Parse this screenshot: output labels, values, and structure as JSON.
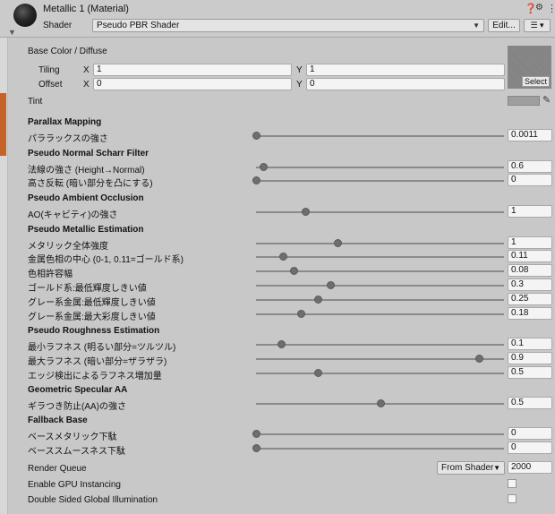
{
  "header": {
    "title": "Metallic 1 (Material)",
    "shader_label": "Shader",
    "shader_value": "Pseudo PBR Shader",
    "edit_label": "Edit...",
    "list_label": "☰ ▾"
  },
  "base": {
    "title": "Base Color / Diffuse",
    "tiling_label": "Tiling",
    "offset_label": "Offset",
    "x_label": "X",
    "y_label": "Y",
    "tiling_x": "1",
    "tiling_y": "1",
    "offset_x": "0",
    "offset_y": "0",
    "select_label": "Select",
    "tint_label": "Tint"
  },
  "sections": [
    {
      "title": "Parallax Mapping",
      "rows": [
        {
          "label": "パララックスの強さ",
          "value": "0.0011",
          "fraction": 0.0
        }
      ]
    },
    {
      "title": "Pseudo Normal Scharr Filter",
      "rows": [
        {
          "label": "法線の強さ (Height→Normal)",
          "value": "0.6",
          "fraction": 0.03
        },
        {
          "label": "高さ反転 (暗い部分を凸にする)",
          "value": "0",
          "fraction": 0.0
        }
      ]
    },
    {
      "title": "Pseudo Ambient Occlusion",
      "rows": [
        {
          "label": "AO(キャビティ)の強さ",
          "value": "1",
          "fraction": 0.2
        }
      ]
    },
    {
      "title": "Pseudo Metallic Estimation",
      "rows": [
        {
          "label": "メタリック全体強度",
          "value": "1",
          "fraction": 0.33
        },
        {
          "label": "金属色相の中心 (0-1, 0.11=ゴールド系)",
          "value": "0.11",
          "fraction": 0.11
        },
        {
          "label": "色相許容幅",
          "value": "0.08",
          "fraction": 0.15
        },
        {
          "label": "ゴールド系:最低輝度しきい値",
          "value": "0.3",
          "fraction": 0.3
        },
        {
          "label": "グレー系金属:最低輝度しきい値",
          "value": "0.25",
          "fraction": 0.25
        },
        {
          "label": "グレー系金属:最大彩度しきい値",
          "value": "0.18",
          "fraction": 0.18
        }
      ]
    },
    {
      "title": "Pseudo Roughness Estimation",
      "rows": [
        {
          "label": "最小ラフネス (明るい部分=ツルツル)",
          "value": "0.1",
          "fraction": 0.1
        },
        {
          "label": "最大ラフネス (暗い部分=ザラザラ)",
          "value": "0.9",
          "fraction": 0.9
        },
        {
          "label": "エッジ検出によるラフネス増加量",
          "value": "0.5",
          "fraction": 0.25
        }
      ]
    },
    {
      "title": "Geometric Specular AA",
      "rows": [
        {
          "label": "ギラつき防止(AA)の強さ",
          "value": "0.5",
          "fraction": 0.5
        }
      ]
    },
    {
      "title": "Fallback Base",
      "rows": [
        {
          "label": "ベースメタリック下駄",
          "value": "0",
          "fraction": 0.0
        },
        {
          "label": "ベーススムースネス下駄",
          "value": "0",
          "fraction": 0.0
        }
      ]
    }
  ],
  "footer": {
    "render_queue_label": "Render Queue",
    "render_queue_mode": "From Shader",
    "render_queue_value": "2000",
    "gpu_instancing_label": "Enable GPU Instancing",
    "gpu_instancing_checked": false,
    "double_sided_label": "Double Sided Global Illumination",
    "double_sided_checked": false
  },
  "colors": {
    "panel_bg": "#c8c8c8",
    "tint": "#9e9e9e",
    "accent_strip": "#c5622a"
  }
}
